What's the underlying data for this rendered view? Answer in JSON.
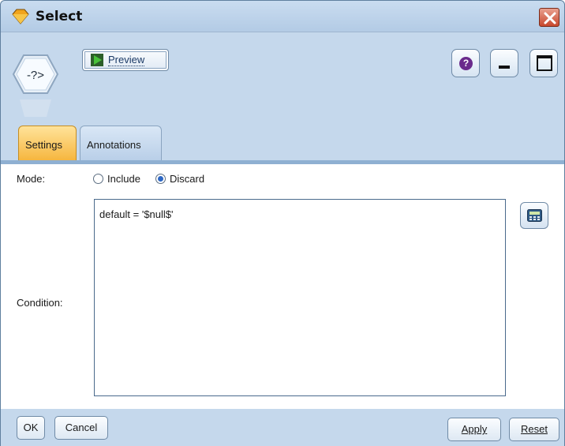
{
  "window": {
    "title": "Select",
    "close_icon": "close-icon",
    "app_icon": "diamond-node-icon"
  },
  "toolbar": {
    "node_icon": "select-node-icon",
    "node_icon_glyph": "-?>",
    "preview_label": "Preview",
    "help_icon": "help-icon",
    "help_glyph": "?",
    "minimize_icon": "minimize-icon",
    "maximize_icon": "maximize-icon"
  },
  "tabs": [
    {
      "label": "Settings",
      "active": true
    },
    {
      "label": "Annotations",
      "active": false
    }
  ],
  "settings": {
    "mode_label": "Mode:",
    "mode_options": [
      {
        "label": "Include",
        "selected": false
      },
      {
        "label": "Discard",
        "selected": true
      }
    ],
    "condition_label": "Condition:",
    "condition_value": "default = '$null$'",
    "expression_builder_icon": "calculator-icon"
  },
  "buttons": {
    "ok": "OK",
    "cancel": "Cancel",
    "apply": "Apply",
    "reset": "Reset"
  },
  "colors": {
    "window_bg": "#c5d8ec",
    "active_tab": "#f6b63f",
    "close_button": "#c8482e",
    "help_icon": "#6a2b8c"
  }
}
